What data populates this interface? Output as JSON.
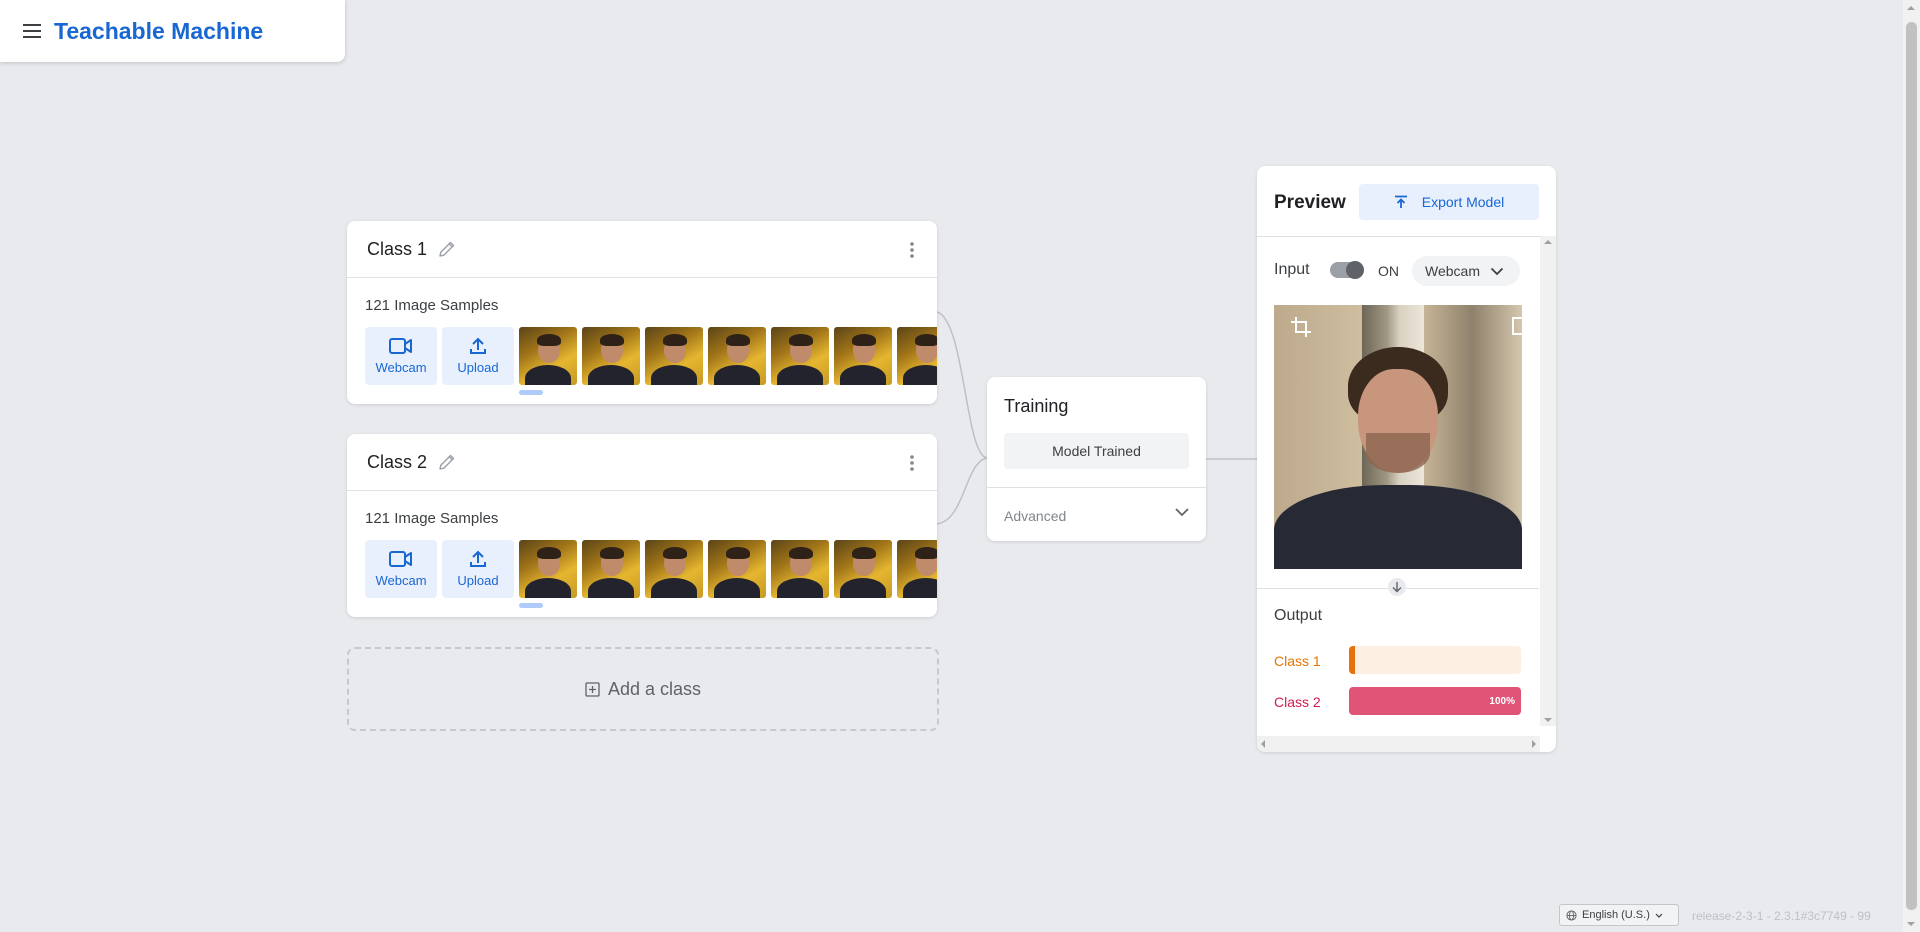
{
  "header": {
    "title": "Teachable Machine",
    "menu_icon": "menu-icon"
  },
  "classes": [
    {
      "name": "Class 1",
      "samples_text": "121 Image Samples",
      "webcam_label": "Webcam",
      "upload_label": "Upload"
    },
    {
      "name": "Class 2",
      "samples_text": "121 Image Samples",
      "webcam_label": "Webcam",
      "upload_label": "Upload"
    }
  ],
  "add_class": {
    "label": "Add a class"
  },
  "training": {
    "title": "Training",
    "status_button": "Model Trained",
    "advanced_label": "Advanced"
  },
  "preview": {
    "title": "Preview",
    "export_label": "Export Model",
    "input_label": "Input",
    "toggle_state": "ON",
    "input_source": "Webcam",
    "output_label": "Output",
    "outputs": [
      {
        "label": "Class 1",
        "color": "#e37400",
        "track_color": "#feefe3",
        "fill_color": "#e8710a",
        "value": 0,
        "value_text": ""
      },
      {
        "label": "Class 2",
        "color": "#d01c4f",
        "track_color": "#fce8ec",
        "fill_color": "#e05478",
        "value": 1.0,
        "value_text": "100%"
      }
    ]
  },
  "footer": {
    "language": "English (U.S.)",
    "release": "release-2-3-1 - 2.3.1#3c7749 - 99"
  },
  "colors": {
    "accent": "#1967d2",
    "background": "#e8eaed"
  }
}
